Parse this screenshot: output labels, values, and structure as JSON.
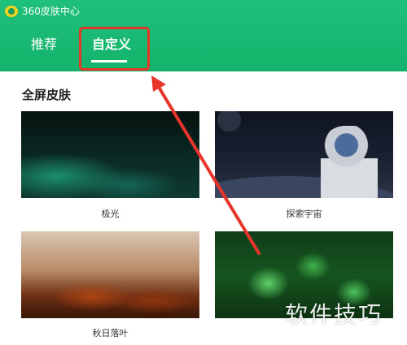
{
  "window": {
    "title": "360皮肤中心"
  },
  "tabs": [
    {
      "label": "推荐",
      "active": false
    },
    {
      "label": "自定义",
      "active": true
    }
  ],
  "section": {
    "title": "全屏皮肤"
  },
  "skins": [
    {
      "name": "极光"
    },
    {
      "name": "探索宇宙"
    },
    {
      "name": "秋日落叶"
    },
    {
      "name": ""
    }
  ],
  "watermark": "软件技巧",
  "colors": {
    "header": "#1bba72",
    "annotation": "#e8352a"
  }
}
